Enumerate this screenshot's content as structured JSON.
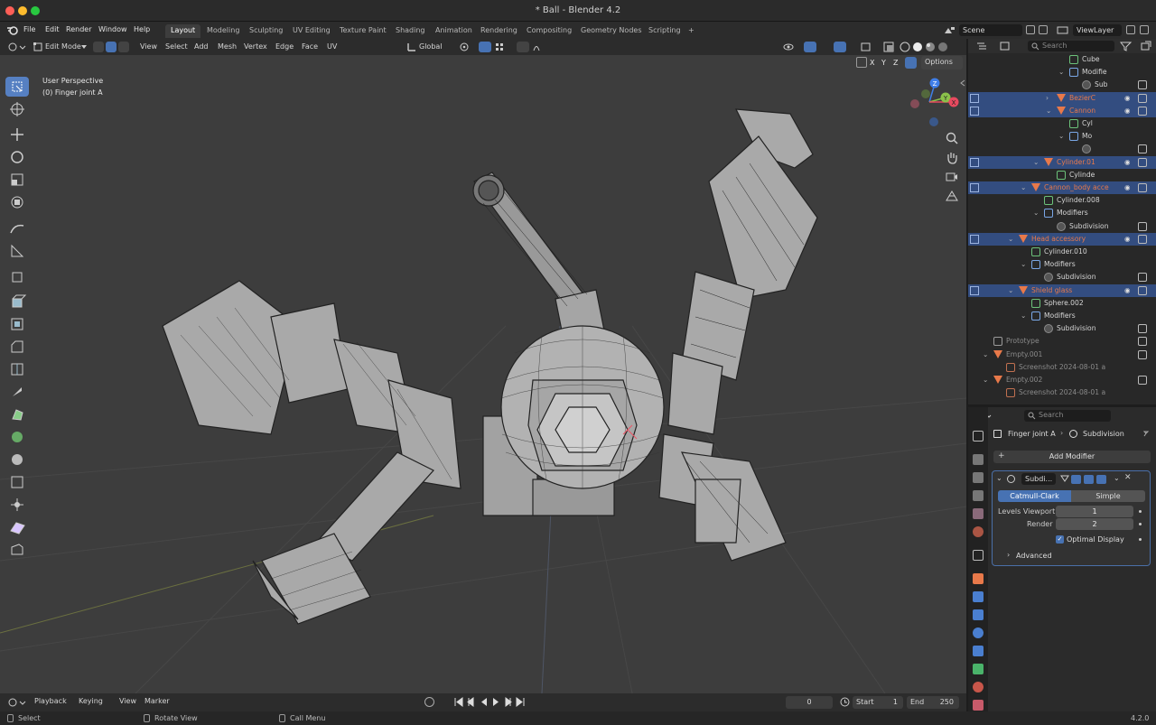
{
  "window": {
    "title": "* Ball - Blender 4.2"
  },
  "menu": {
    "items": [
      "File",
      "Edit",
      "Render",
      "Window",
      "Help"
    ]
  },
  "workspaces": {
    "tabs": [
      "Layout",
      "Modeling",
      "Sculpting",
      "UV Editing",
      "Texture Paint",
      "Shading",
      "Animation",
      "Rendering",
      "Compositing",
      "Geometry Nodes",
      "Scripting"
    ],
    "active": "Layout",
    "add": "+"
  },
  "scene": {
    "name": "Scene",
    "view_layer": "ViewLayer"
  },
  "viewport_header": {
    "mode": "Edit Mode",
    "menus": [
      "View",
      "Select",
      "Add",
      "Mesh",
      "Vertex",
      "Edge",
      "Face",
      "UV"
    ],
    "orientation": "Global",
    "axes": [
      "X",
      "Y",
      "Z"
    ],
    "options": "Options"
  },
  "viewport": {
    "view_name": "User Perspective",
    "object_info": "(0) Finger joint A"
  },
  "gizmo": {
    "axes": [
      "Z",
      "Y",
      "X"
    ],
    "colors": {
      "x": "#e84a5f",
      "y": "#8bc24a",
      "z": "#3f7ee8"
    }
  },
  "outliner": {
    "search_placeholder": "Search",
    "rows": [
      {
        "label": "Cube",
        "depth": 7,
        "kind": "mesh",
        "selected": false,
        "accent": false,
        "expand": ""
      },
      {
        "label": "Modifie",
        "depth": 7,
        "kind": "modifier",
        "selected": false,
        "accent": false,
        "expand": "v"
      },
      {
        "label": "Sub",
        "depth": 8,
        "kind": "subdiv",
        "selected": false,
        "accent": false,
        "expand": ""
      },
      {
        "label": "BezierC",
        "depth": 6,
        "kind": "object",
        "selected": true,
        "accent": true,
        "expand": ">"
      },
      {
        "label": "Cannon",
        "depth": 6,
        "kind": "object",
        "selected": true,
        "accent": true,
        "expand": "v"
      },
      {
        "label": "Cyl",
        "depth": 7,
        "kind": "mesh",
        "selected": false,
        "accent": false,
        "expand": ""
      },
      {
        "label": "Mo",
        "depth": 7,
        "kind": "modifier",
        "selected": false,
        "accent": false,
        "expand": "v"
      },
      {
        "label": "",
        "depth": 8,
        "kind": "subdiv",
        "selected": false,
        "accent": false,
        "expand": ""
      },
      {
        "label": "Cylinder.01",
        "depth": 5,
        "kind": "object",
        "selected": true,
        "accent": true,
        "expand": "v"
      },
      {
        "label": "Cylinde",
        "depth": 6,
        "kind": "mesh",
        "selected": false,
        "accent": false,
        "expand": ""
      },
      {
        "label": "Cannon_body acce",
        "depth": 4,
        "kind": "object",
        "selected": true,
        "accent": true,
        "expand": "v"
      },
      {
        "label": "Cylinder.008",
        "depth": 5,
        "kind": "mesh",
        "selected": false,
        "accent": false,
        "expand": ""
      },
      {
        "label": "Modifiers",
        "depth": 5,
        "kind": "modifier",
        "selected": false,
        "accent": false,
        "expand": "v"
      },
      {
        "label": "Subdivision",
        "depth": 6,
        "kind": "subdiv",
        "selected": false,
        "accent": false,
        "expand": ""
      },
      {
        "label": "Head accessory",
        "depth": 3,
        "kind": "object",
        "selected": true,
        "accent": true,
        "expand": "v"
      },
      {
        "label": "Cylinder.010",
        "depth": 4,
        "kind": "mesh",
        "selected": false,
        "accent": false,
        "expand": ""
      },
      {
        "label": "Modifiers",
        "depth": 4,
        "kind": "modifier",
        "selected": false,
        "accent": false,
        "expand": "v"
      },
      {
        "label": "Subdivision",
        "depth": 5,
        "kind": "subdiv",
        "selected": false,
        "accent": false,
        "expand": ""
      },
      {
        "label": "Shield glass",
        "depth": 3,
        "kind": "object",
        "selected": true,
        "accent": true,
        "expand": "v"
      },
      {
        "label": "Sphere.002",
        "depth": 4,
        "kind": "mesh",
        "selected": false,
        "accent": false,
        "expand": ""
      },
      {
        "label": "Modifiers",
        "depth": 4,
        "kind": "modifier",
        "selected": false,
        "accent": false,
        "expand": "v"
      },
      {
        "label": "Subdivision",
        "depth": 5,
        "kind": "subdiv",
        "selected": false,
        "accent": false,
        "expand": ""
      },
      {
        "label": "Prototype",
        "depth": 1,
        "kind": "collection",
        "selected": false,
        "accent": false,
        "expand": "",
        "dim": true
      },
      {
        "label": "Empty.001",
        "depth": 1,
        "kind": "empty",
        "selected": false,
        "accent": false,
        "expand": "v",
        "dim": true
      },
      {
        "label": "Screenshot 2024-08-01 a",
        "depth": 2,
        "kind": "image",
        "selected": false,
        "accent": false,
        "expand": "",
        "dim": true
      },
      {
        "label": "Empty.002",
        "depth": 1,
        "kind": "empty",
        "selected": false,
        "accent": false,
        "expand": "v",
        "dim": true
      },
      {
        "label": "Screenshot 2024-08-01 a",
        "depth": 2,
        "kind": "image",
        "selected": false,
        "accent": false,
        "expand": "",
        "dim": true
      }
    ]
  },
  "properties": {
    "search_placeholder": "Search",
    "breadcrumb": {
      "object": "Finger joint A",
      "modifier": "Subdivision"
    },
    "add_modifier": "Add Modifier",
    "modifier": {
      "name": "Subdi...",
      "mode_catmull": "Catmull-Clark",
      "mode_simple": "Simple",
      "levels_viewport_label": "Levels Viewport",
      "levels_viewport_value": "1",
      "render_label": "Render",
      "render_value": "2",
      "optimal_display": "Optimal Display",
      "advanced": "Advanced"
    }
  },
  "timeline": {
    "playback": "Playback",
    "keying": "Keying",
    "view": "View",
    "marker": "Marker",
    "current_frame": "0",
    "start_label": "Start",
    "start": "1",
    "end_label": "End",
    "end": "250"
  },
  "statusbar": {
    "select": "Select",
    "rotate": "Rotate View",
    "call_menu": "Call Menu",
    "version": "4.2.0"
  },
  "colors": {
    "selection": "#334d80",
    "accent_orange": "#e8794a",
    "active_tool": "#5680c2",
    "viewport_bg": "#3d3d3d"
  }
}
